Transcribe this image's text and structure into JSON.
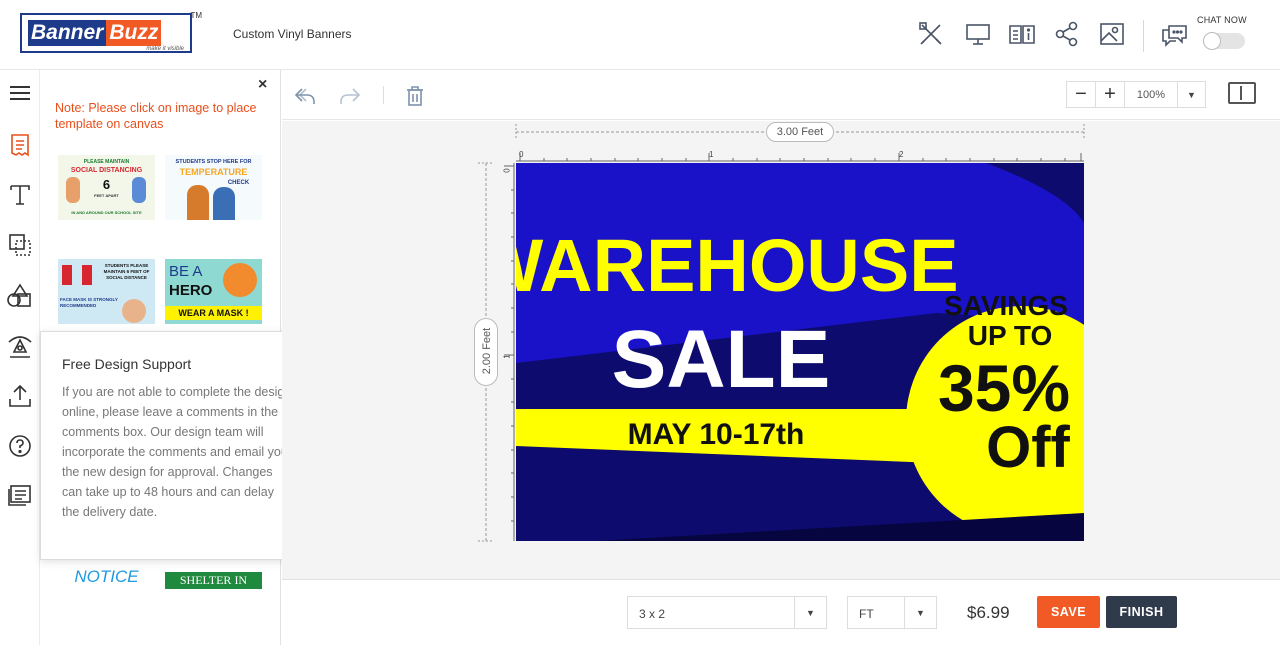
{
  "header": {
    "logo_part1": "Banner",
    "logo_part2": "Buzz",
    "logo_tm": "TM",
    "logo_tagline": "make it visible",
    "product_title": "Custom Vinyl Banners",
    "chat_label": "CHAT NOW",
    "chat_enabled": false,
    "icons": [
      "design-tools-icon",
      "monitor-icon",
      "book-info-icon",
      "share-icon",
      "image-icon",
      "chat-icon"
    ]
  },
  "rail": {
    "icons": [
      "menu-icon",
      "templates-icon",
      "text-icon",
      "shapes-icon",
      "clipart-icon",
      "background-icon",
      "upload-icon",
      "help-icon",
      "comments-icon"
    ]
  },
  "panel": {
    "close": "×",
    "note": "Note: Please click on image to place template on canvas",
    "templates": [
      {
        "title": "PLEASE MAINTAIN",
        "main": "SOCIAL DISTANCING",
        "num": "6",
        "sub": "FEET APART",
        "foot": "IN AND AROUND OUR SCHOOL SITE"
      },
      {
        "title": "STUDENTS STOP HERE FOR",
        "main": "TEMPERATURE",
        "sub": "CHECK"
      },
      {
        "title": "STUDENTS PLEASE MAINTAIN 6 FEET OF SOCIAL DISTANCE",
        "main": "FACE MASK IS STRONGLY RECOMMENDED"
      },
      {
        "title": "BE A",
        "main": "HERO",
        "sub": "WEAR A MASK !"
      },
      {
        "title": "NOTICE"
      },
      {
        "title": "SHELTER IN PLACE"
      }
    ]
  },
  "popup": {
    "title": "Free Design Support",
    "close": "×",
    "body": "If you are not able to complete the design online, please leave a comments in the comments box. Our design team will incorporate the comments and email you the new design for approval. Changes can take up to 48 hours and can delay the delivery date."
  },
  "toolbar": {
    "zoom_out": "−",
    "zoom_in": "+",
    "zoom_value": "100%",
    "dropdown_caret": "▼"
  },
  "canvas": {
    "width_label": "3.00 Feet",
    "height_label": "2.00 Feet",
    "ruler_top": [
      "0",
      "1",
      "2"
    ],
    "ruler_left": [
      "0",
      "1"
    ],
    "banner": {
      "headline": "WAREHOUSE",
      "subhead": "SALE",
      "dates": "MAY 10-17th",
      "savings_line1": "SAVINGS",
      "savings_line2": "UP TO",
      "percent": "35%",
      "off": "Off",
      "colors": {
        "primary_blue": "#1a12c8",
        "dark_navy": "#0d0b6e",
        "yellow": "#ffff00",
        "white": "#ffffff",
        "black": "#111111"
      }
    }
  },
  "footer": {
    "size_value": "3 x 2",
    "unit_value": "FT",
    "price": "$6.99",
    "save_label": "SAVE",
    "finish_label": "FINISH",
    "caret": "▼"
  },
  "colors": {
    "accent_orange": "#f15a24",
    "dark_button": "#2f3a4a",
    "brand_blue": "#1e3a8a"
  }
}
